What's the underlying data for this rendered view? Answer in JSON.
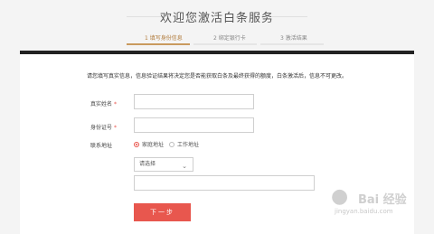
{
  "header": {
    "title": "欢迎您激活白条服务",
    "steps": [
      {
        "label": "1  填写身份信息"
      },
      {
        "label": "2  绑定银行卡"
      },
      {
        "label": "3  激活结果"
      }
    ],
    "accent_color": "#b07a3a"
  },
  "form": {
    "notice": "请您填写真实信息，信息验证结果将决定您是否能获取白条及最终获得的额度，白条激活后，信息不可更改。",
    "name_label": "真实姓名",
    "id_label": "身份证号",
    "address_label": "联系地址",
    "required_mark": "*",
    "address_types": [
      {
        "label": "家庭地址",
        "selected": true
      },
      {
        "label": "工作地址",
        "selected": false
      }
    ],
    "region_select": "请选择",
    "next_button": "下一步"
  },
  "watermark": {
    "brand": "Bai 经验",
    "url": "jingyan.baidu.com"
  },
  "colors": {
    "primary_button": "#e8574e",
    "required": "#e8534a"
  }
}
